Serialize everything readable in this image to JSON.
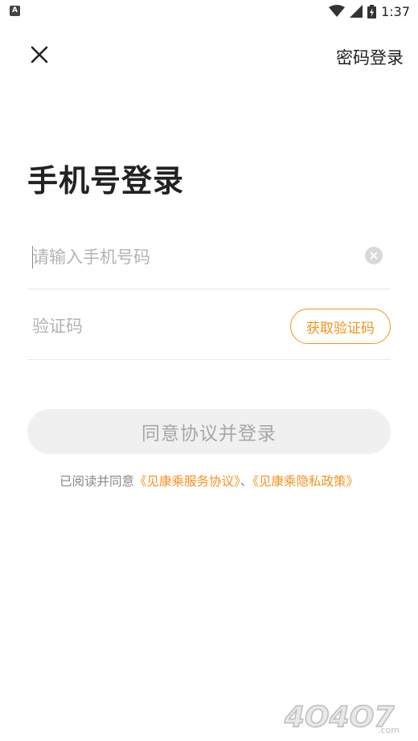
{
  "status_bar": {
    "time": "1:37",
    "left_icon_letter": "A"
  },
  "header": {
    "password_login": "密码登录"
  },
  "title": "手机号登录",
  "phone_field": {
    "placeholder": "请输入手机号码",
    "value": ""
  },
  "code_field": {
    "placeholder": "验证码",
    "value": ""
  },
  "get_code_button": "获取验证码",
  "submit_button": "同意协议并登录",
  "agreement": {
    "prefix": "已阅读并同意",
    "service_link": "《见康乘服务协议》",
    "separator": "、",
    "privacy_link": "《见康乘隐私政策》"
  },
  "watermark": {
    "text": "4O4O7",
    "suffix": ".com"
  },
  "colors": {
    "accent": "#f5911e",
    "button_disabled_bg": "#f0f0f0",
    "button_disabled_text": "#a6a6a6"
  }
}
